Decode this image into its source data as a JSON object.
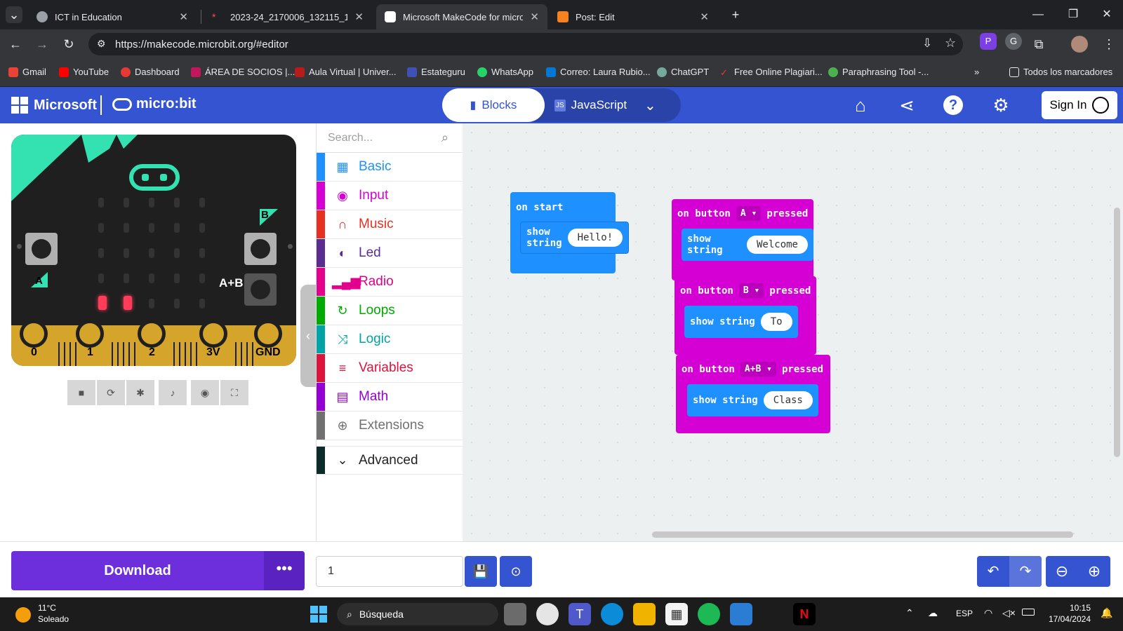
{
  "browser": {
    "tabs": [
      {
        "title": "ICT in Education"
      },
      {
        "title": "2023-24_2170006_132115_177..."
      },
      {
        "title": "Microsoft MakeCode for micro:b"
      },
      {
        "title": "Post: Edit"
      }
    ],
    "url": "https://makecode.microbit.org/#editor",
    "bookmarks": [
      "Gmail",
      "YouTube",
      "Dashboard",
      "ÁREA DE SOCIOS |...",
      "Aula Virtual | Univer...",
      "Estateguru",
      "WhatsApp",
      "Correo: Laura Rubio...",
      "ChatGPT",
      "Free Online Plagiari...",
      "Paraphrasing Tool -..."
    ],
    "all_bookmarks": "Todos los marcadores",
    "bookmark_overflow": "»"
  },
  "header": {
    "brand": "Microsoft",
    "product": "micro:bit",
    "blocks_label": "Blocks",
    "javascript_label": "JavaScript",
    "signin_label": "Sign In"
  },
  "simulator": {
    "pins": [
      "0",
      "1",
      "2",
      "3V",
      "GND"
    ],
    "button_a": "A",
    "button_b": "B",
    "button_ab": "A+B"
  },
  "toolbox": {
    "search_placeholder": "Search...",
    "categories": [
      {
        "label": "Basic",
        "color": "#1e90ff",
        "icon": "grid-icon"
      },
      {
        "label": "Input",
        "color": "#d400d4",
        "icon": "input-icon"
      },
      {
        "label": "Music",
        "color": "#e63022",
        "icon": "headphones-icon"
      },
      {
        "label": "Led",
        "color": "#5c2d91",
        "icon": "toggle-icon"
      },
      {
        "label": "Radio",
        "color": "#e3008c",
        "icon": "signal-icon"
      },
      {
        "label": "Loops",
        "color": "#00aa00",
        "icon": "loop-icon"
      },
      {
        "label": "Logic",
        "color": "#00a4a6",
        "icon": "shuffle-icon"
      },
      {
        "label": "Variables",
        "color": "#dc143c",
        "icon": "list-icon"
      },
      {
        "label": "Math",
        "color": "#9400d3",
        "icon": "calculator-icon"
      },
      {
        "label": "Extensions",
        "color": "#717171",
        "icon": "plus-circle-icon"
      }
    ],
    "advanced_label": "Advanced"
  },
  "workspace": {
    "on_start": {
      "label": "on start",
      "show_string": "show string",
      "value": "Hello!"
    },
    "button_a": {
      "on": "on button",
      "button": "A",
      "pressed": "pressed",
      "show_string": "show string",
      "value": "Welcome"
    },
    "button_b": {
      "on": "on button",
      "button": "B",
      "pressed": "pressed",
      "show_string": "show string",
      "value": "To"
    },
    "button_ab": {
      "on": "on button",
      "button": "A+B",
      "pressed": "pressed",
      "show_string": "show string",
      "value": "Class"
    }
  },
  "bottom": {
    "download_label": "Download",
    "project_name": "1"
  },
  "taskbar": {
    "temperature": "11°C",
    "weather": "Soleado",
    "search_label": "Búsqueda",
    "language": "ESP",
    "time": "10:15",
    "date": "17/04/2024"
  }
}
